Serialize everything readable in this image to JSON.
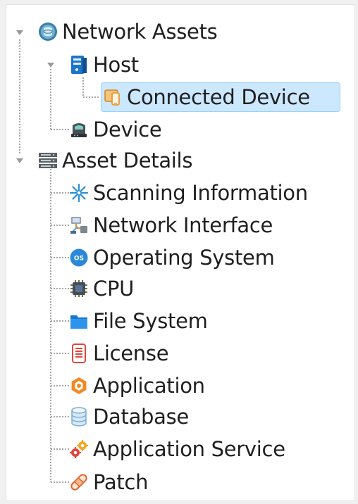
{
  "tree": {
    "network_assets": {
      "label": "Network Assets",
      "icon": "database-globe-icon",
      "children": {
        "host": {
          "label": "Host",
          "icon": "server-icon",
          "children": {
            "connected_device": {
              "label": "Connected Device",
              "icon": "devices-icon",
              "selected": true
            }
          }
        },
        "device": {
          "label": "Device",
          "icon": "router-icon"
        }
      }
    },
    "asset_details": {
      "label": "Asset Details",
      "icon": "server-rack-icon",
      "children": [
        {
          "label": "Scanning Information",
          "icon": "scan-star-icon"
        },
        {
          "label": "Network Interface",
          "icon": "network-interface-icon"
        },
        {
          "label": "Operating System",
          "icon": "os-icon"
        },
        {
          "label": "CPU",
          "icon": "cpu-chip-icon"
        },
        {
          "label": "File System",
          "icon": "folder-icon"
        },
        {
          "label": "License",
          "icon": "license-document-icon"
        },
        {
          "label": "Application",
          "icon": "application-gear-icon"
        },
        {
          "label": "Database",
          "icon": "database-icon"
        },
        {
          "label": "Application Service",
          "icon": "service-gears-icon"
        },
        {
          "label": "Patch",
          "icon": "patch-bandage-icon"
        }
      ]
    }
  },
  "colors": {
    "selection_bg": "#cce8ff",
    "selection_border": "#99d1ff",
    "tree_line": "#8a8a8a"
  }
}
